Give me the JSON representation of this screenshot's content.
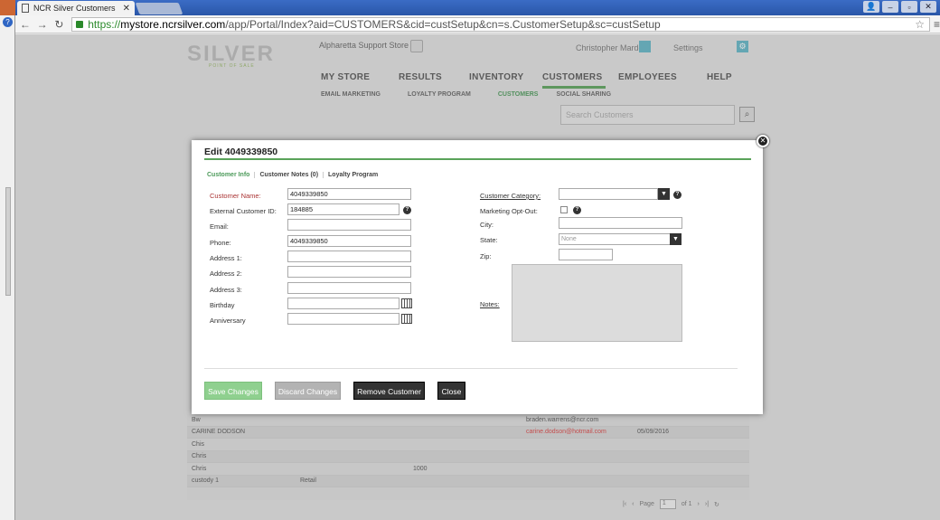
{
  "browser": {
    "tab_title": "NCR Silver Customers",
    "url_scheme": "https://",
    "url_host": "mystore.ncrsilver.com",
    "url_path": "/app/Portal/Index?aid=CUSTOMERS&cid=custSetup&cn=s.CustomerSetup&sc=custSetup"
  },
  "header": {
    "logo": "SILVER",
    "logo_sub": "POINT OF SALE",
    "store_name": "Alpharetta Support Store",
    "user_name": "Christopher Marder",
    "settings_label": "Settings"
  },
  "main_nav": [
    "MY STORE",
    "RESULTS",
    "INVENTORY",
    "CUSTOMERS",
    "EMPLOYEES",
    "HELP"
  ],
  "sub_nav": [
    "EMAIL MARKETING",
    "LOYALTY PROGRAM",
    "CUSTOMERS",
    "SOCIAL SHARING"
  ],
  "search": {
    "placeholder": "Search Customers"
  },
  "table_rows": [
    [
      "Bw",
      "",
      "",
      "braden.warrens@ncr.com",
      ""
    ],
    [
      "CARINE DODSON",
      "",
      "",
      "carine.dodson@hotmail.com",
      "05/09/2016"
    ],
    [
      "Chis",
      "",
      "",
      "",
      ""
    ],
    [
      "Chris",
      "",
      "",
      "",
      ""
    ],
    [
      "Chris",
      "",
      "1000",
      "",
      ""
    ],
    [
      "custody 1",
      "Retail",
      "",
      "",
      ""
    ]
  ],
  "pager": {
    "page_label": "Page",
    "current": "1",
    "of_label": "of 1"
  },
  "modal": {
    "title": "Edit 4049339850",
    "tabs": [
      "Customer Info",
      "Customer Notes (0)",
      "Loyalty Program"
    ],
    "fields": {
      "customer_name": {
        "label": "Customer Name:",
        "value": "4049339850"
      },
      "external_id": {
        "label": "External Customer ID:",
        "value": "184885"
      },
      "email": {
        "label": "Email:",
        "value": ""
      },
      "phone": {
        "label": "Phone:",
        "value": "4049339850"
      },
      "address1": {
        "label": "Address 1:",
        "value": ""
      },
      "address2": {
        "label": "Address 2:",
        "value": ""
      },
      "address3": {
        "label": "Address 3:",
        "value": ""
      },
      "birthday": {
        "label": "Birthday",
        "value": ""
      },
      "anniversary": {
        "label": "Anniversary",
        "value": ""
      },
      "category": {
        "label": "Customer Category:",
        "value": ""
      },
      "opt_out": {
        "label": "Marketing Opt-Out:"
      },
      "city": {
        "label": "City:",
        "value": ""
      },
      "state": {
        "label": "State:",
        "value": "None"
      },
      "zip": {
        "label": "Zip:",
        "value": ""
      },
      "notes": {
        "label": "Notes:"
      }
    },
    "buttons": {
      "save": "Save Changes",
      "discard": "Discard Changes",
      "remove": "Remove Customer",
      "close": "Close"
    }
  }
}
